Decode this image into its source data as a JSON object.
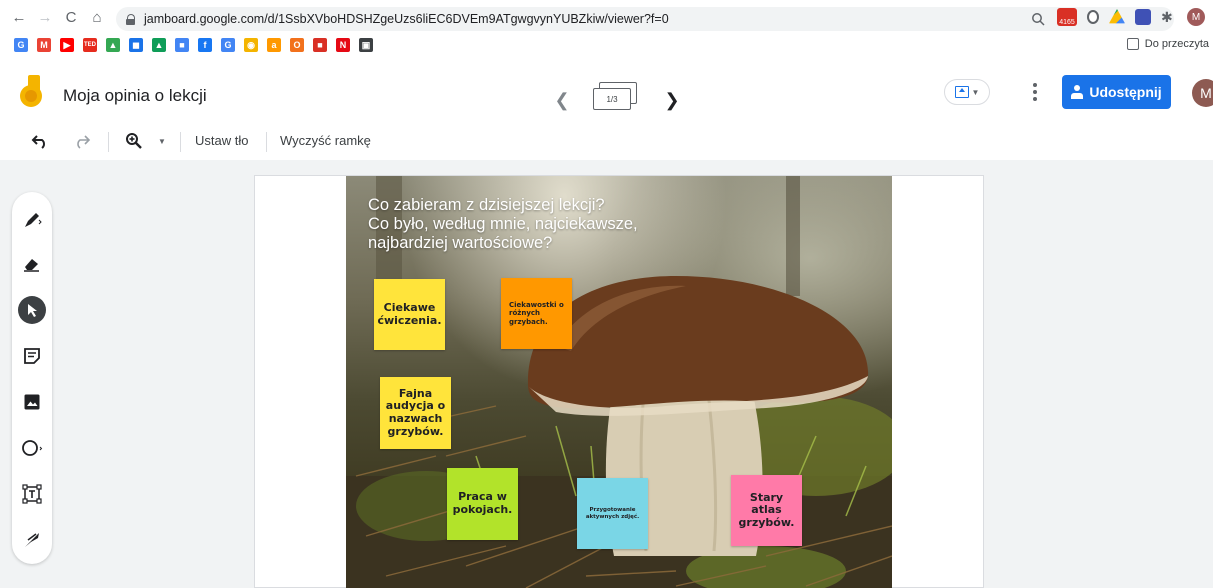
{
  "browser": {
    "url": "jamboard.google.com/d/1SsbXVboHDSHZgeUzs6liEC6DVEm9ATgwgvynYUBZkiw/viewer?f=0",
    "back": "←",
    "forward": "→",
    "reload": "C",
    "home": "⌂",
    "zoom_icon": "search-icon",
    "star_icon": "star-icon",
    "gmail_badge": "4165",
    "profile_initial": "M",
    "reading_list": "Do przeczyta"
  },
  "bookmarks": [
    {
      "label": "G",
      "color": "#4285f4"
    },
    {
      "label": "M",
      "color": "#ea4335"
    },
    {
      "label": "▶",
      "color": "#ff0000"
    },
    {
      "label": "TED",
      "color": "#e62b1e"
    },
    {
      "label": "▲",
      "color": "#34a853"
    },
    {
      "label": "◼",
      "color": "#1a73e8"
    },
    {
      "label": "▲",
      "color": "#0f9d58"
    },
    {
      "label": "■",
      "color": "#4285f4"
    },
    {
      "label": "f",
      "color": "#1877f2"
    },
    {
      "label": "G",
      "color": "#4285f4"
    },
    {
      "label": "◉",
      "color": "#f4b400"
    },
    {
      "label": "a",
      "color": "#ff9900"
    },
    {
      "label": "O",
      "color": "#f2711c"
    },
    {
      "label": "■",
      "color": "#d93025"
    },
    {
      "label": "N",
      "color": "#e50914"
    },
    {
      "label": "▣",
      "color": "#3c4043"
    }
  ],
  "app": {
    "title": "Moja opinia o lekcji",
    "frame_indicator": "1/3",
    "share_label": "Udostępnij",
    "user_initial": "M"
  },
  "toolbar": {
    "set_background": "Ustaw tło",
    "clear_frame": "Wyczyść ramkę"
  },
  "tools": [
    "pen-tool",
    "eraser-tool",
    "select-tool",
    "sticky-note-tool",
    "image-tool",
    "circle-tool",
    "text-box-tool",
    "laser-tool"
  ],
  "frame": {
    "heading_lines": [
      "Co zabieram z dzisiejszej lekcji?",
      "Co było, według mnie, najciekawsze,",
      "najbardziej wartościowe?"
    ],
    "notes": [
      {
        "text": "Ciekawe ćwiczenia.",
        "color": "#ffe43b"
      },
      {
        "text": "Ciekawostki o różnych grzybach.",
        "color": "#ff9800"
      },
      {
        "text": "Fajna audycja o nazwach grzybów.",
        "color": "#ffe43b"
      },
      {
        "text": "Praca w pokojach.",
        "color": "#b2e32a"
      },
      {
        "text": "Przygotowanie aktywnych zdjęć.",
        "color": "#7ad6e6"
      },
      {
        "text": "Stary atlas grzybów.",
        "color": "#ff7aa8"
      }
    ]
  }
}
